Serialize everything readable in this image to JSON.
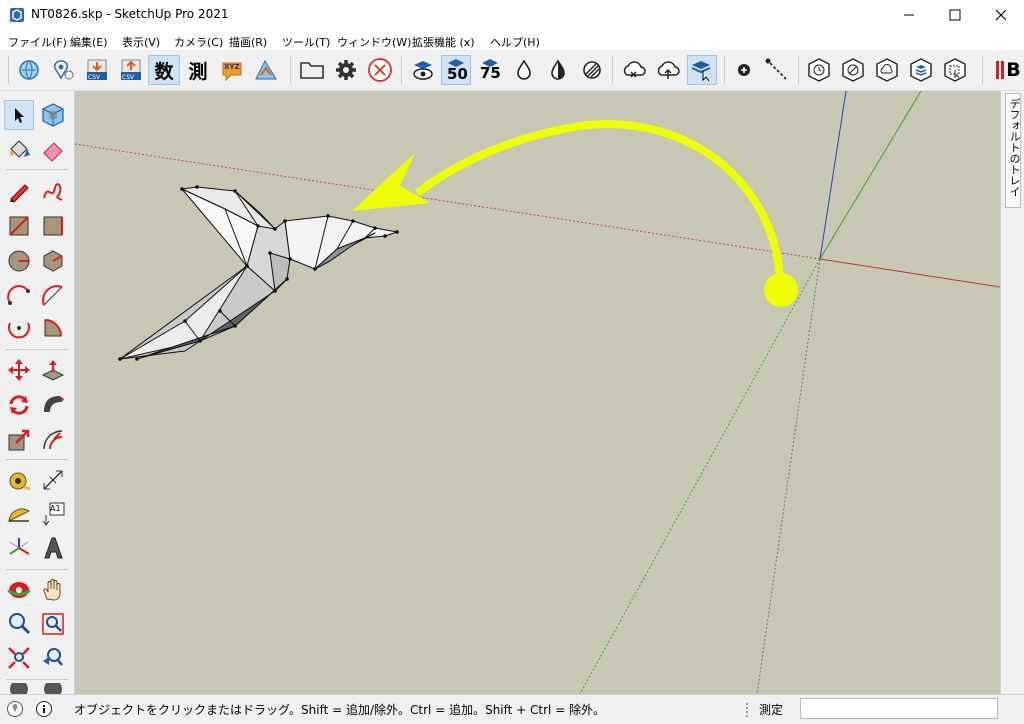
{
  "window": {
    "title": "NT0826.skp - SketchUp Pro 2021",
    "minimize_glyph": "—",
    "maximize_glyph": "☐",
    "close_glyph": "✕"
  },
  "menu": [
    "ファイル(F)",
    "編集(E)",
    "表示(V)",
    "カメラ(C)",
    "描画(R)",
    "ツール(T)",
    "ウィンドウ(W)",
    "拡張機能 (x)",
    "ヘルプ(H)"
  ],
  "toolbar": {
    "kanji_su": "数",
    "kanji_soku": "測",
    "label_50": "50",
    "label_75": "75",
    "csv": "CSV",
    "xyz": "XYZ",
    "extra": "B"
  },
  "tray": {
    "label": "デフォルトのトレイ"
  },
  "status": {
    "message": "オブジェクトをクリックまたはドラッグ。Shift = 追加/除外。Ctrl = 追加。Shift + Ctrl = 除外。",
    "measure_label": "測定",
    "measure_value": ""
  },
  "left_tools": {
    "text_tool_label": "A1"
  },
  "colors": {
    "viewport_bg": "#c8c7b3",
    "arrow": "#eeff00",
    "axis_red": "#cc2b2b",
    "axis_green": "#36a436",
    "axis_blue": "#2b3cc2",
    "selection_blue": "#cfe3f7"
  }
}
